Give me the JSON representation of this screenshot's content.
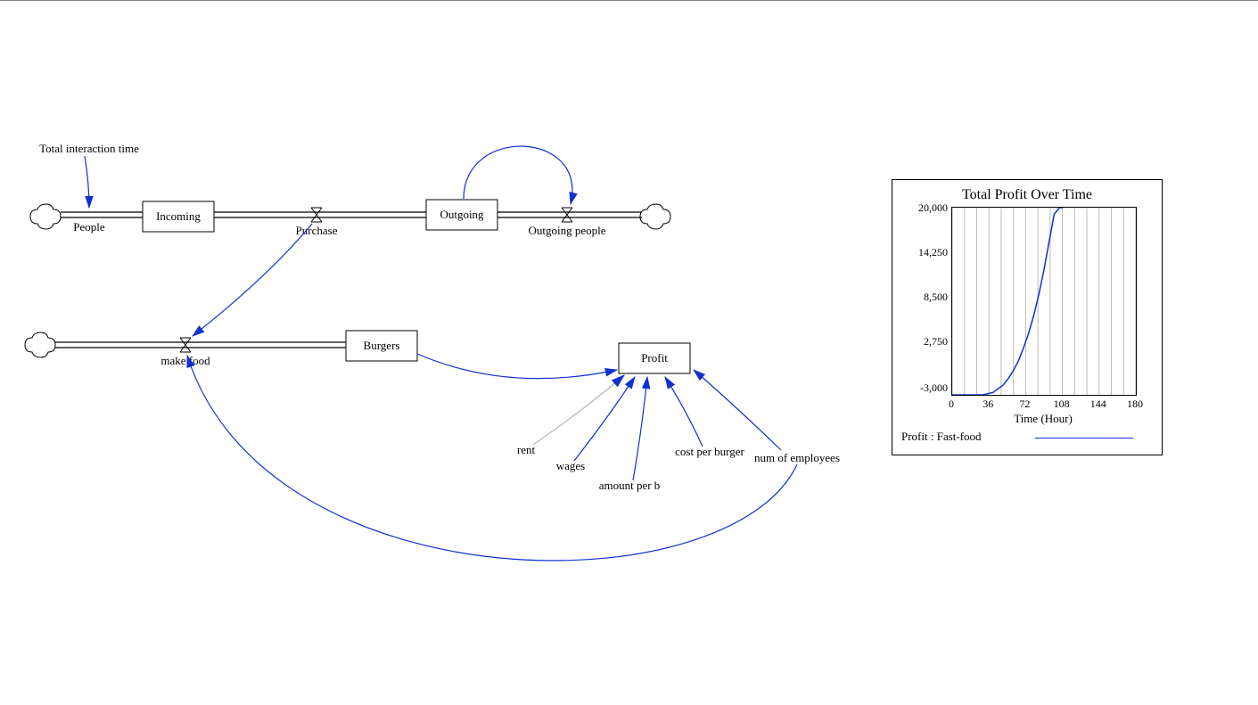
{
  "diagram": {
    "stocks": {
      "incoming": "Incoming",
      "outgoing": "Outgoing",
      "burgers": "Burgers",
      "profit": "Profit"
    },
    "flows": {
      "people": "People",
      "purchase": "Purchase",
      "outgoing_people": "Outgoing people",
      "make_food": "make food"
    },
    "aux": {
      "total_interaction_time": "Total interaction time",
      "rent": "rent",
      "wages": "wages",
      "amount_per_b": "amount per b",
      "cost_per_burger": "cost per burger",
      "num_of_employees": "num of employees"
    }
  },
  "chart": {
    "title": "Total Profit Over Time",
    "xaxis_label": "Time (Hour)",
    "legend": "Profit : Fast-food"
  },
  "chart_data": {
    "type": "line",
    "title": "Total Profit Over Time",
    "xlabel": "Time (Hour)",
    "ylabel": "",
    "legend_position": "bottom",
    "grid": true,
    "x_ticks": [
      0,
      36,
      72,
      108,
      144,
      180
    ],
    "y_ticks": [
      -3000,
      2750,
      8500,
      14250,
      20000
    ],
    "xlim": [
      0,
      180
    ],
    "ylim": [
      -3000,
      20000
    ],
    "series": [
      {
        "name": "Profit : Fast-food",
        "color": "#1030d0",
        "x": [
          0,
          10,
          20,
          30,
          40,
          50,
          55,
          60,
          65,
          70,
          75,
          80,
          85,
          90,
          95,
          100,
          105,
          108
        ],
        "values": [
          -3000,
          -3000,
          -3000,
          -3000,
          -2700,
          -1800,
          -1000,
          0,
          1200,
          2800,
          4600,
          6800,
          9400,
          12400,
          15800,
          19200,
          20000,
          20000
        ]
      }
    ]
  }
}
